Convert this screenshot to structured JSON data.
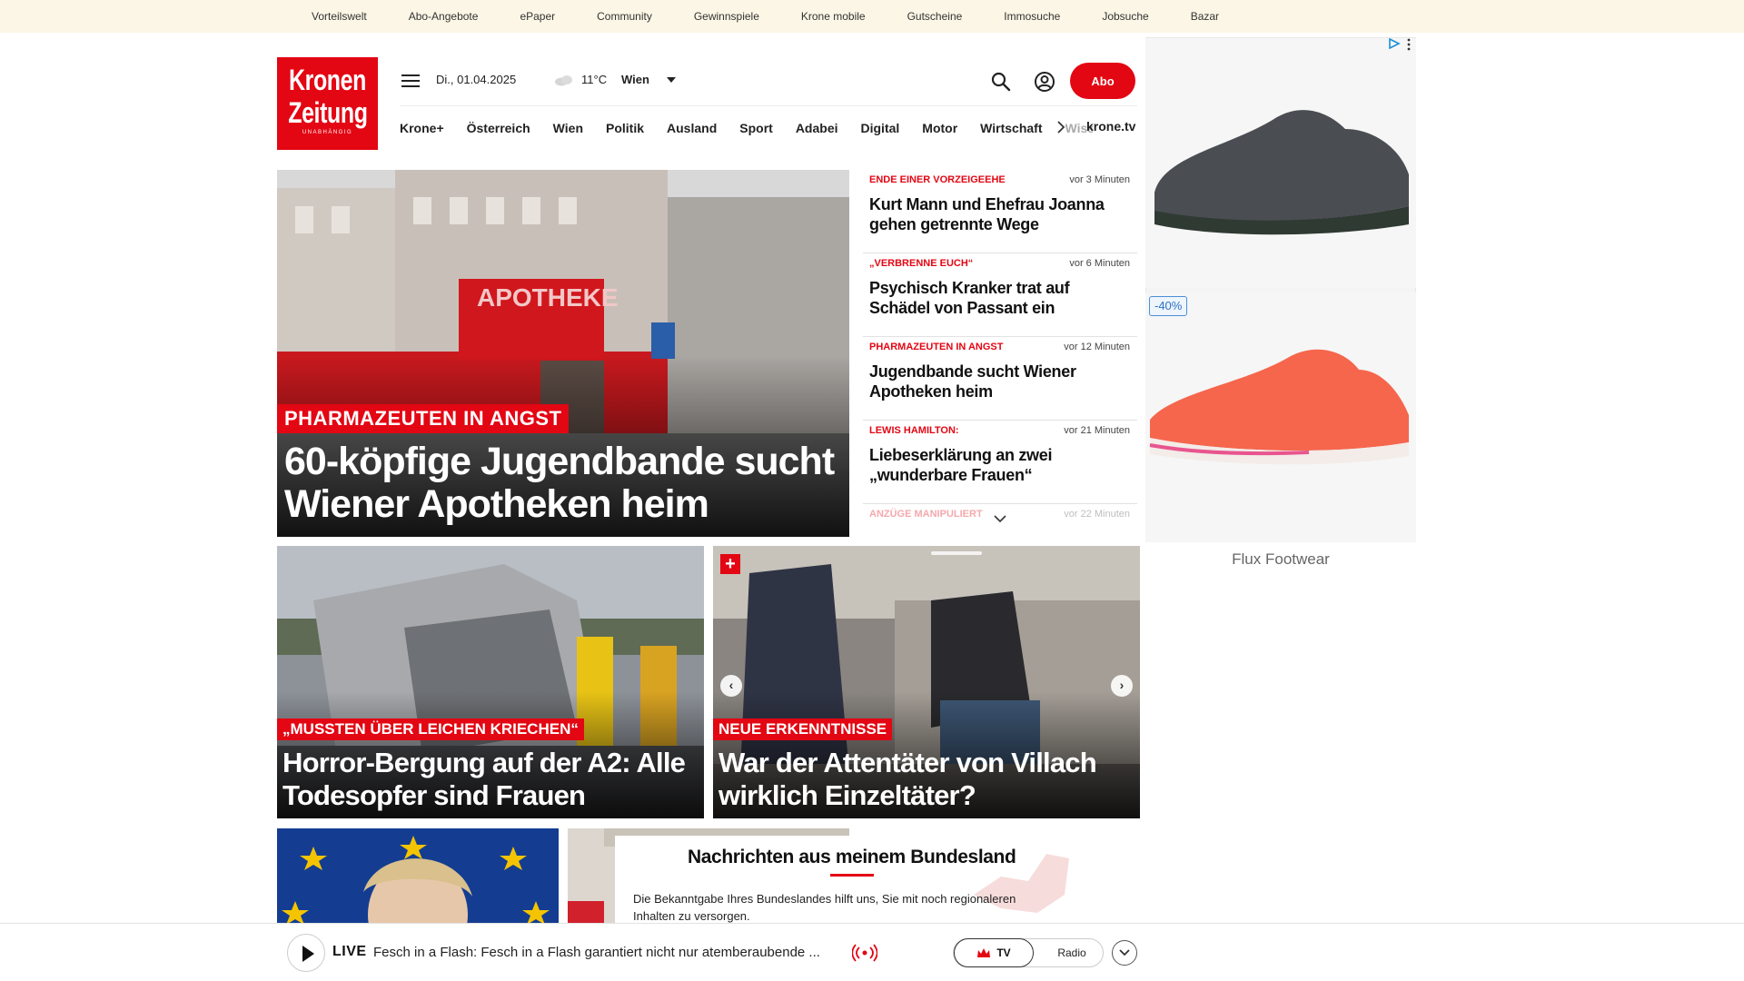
{
  "topbar": {
    "links": [
      "Vorteilswelt",
      "Abo-Angebote",
      "ePaper",
      "Community",
      "Gewinnspiele",
      "Krone mobile",
      "Gutscheine",
      "Immosuche",
      "Jobsuche",
      "Bazar"
    ]
  },
  "logo": {
    "line1": "Kronen",
    "line2": "Zeitung",
    "tagline": "UNABHÄNGIG",
    "color": "#e30613"
  },
  "header": {
    "date": "Di., 01.04.2025",
    "temperature": "11°C",
    "city": "Wien",
    "abo_label": "Abo"
  },
  "categories": [
    "Krone+",
    "Österreich",
    "Wien",
    "Politik",
    "Ausland",
    "Sport",
    "Adabei",
    "Digital",
    "Motor",
    "Wirtschaft",
    "Wiss"
  ],
  "kronetv_label": "krone.tv",
  "hero": {
    "kicker": "PHARMAZEUTEN IN ANGST",
    "title": "60-köpfige Jugendbande sucht Wiener Apotheken heim",
    "sign_text": "APOTHEKE"
  },
  "news": [
    {
      "kicker": "ENDE EINER VORZEIGEEHE",
      "time": "vor 3 Minuten",
      "title": "Kurt Mann und Ehefrau Joanna gehen getrennte Wege"
    },
    {
      "kicker": "„VERBRENNE EUCH“",
      "time": "vor 6 Minuten",
      "title": "Psychisch Kranker trat auf Schädel von Passant ein"
    },
    {
      "kicker": "PHARMAZEUTEN IN ANGST",
      "time": "vor 12 Minuten",
      "title": "Jugendbande sucht Wiener Apotheken heim"
    },
    {
      "kicker": "LEWIS HAMILTON:",
      "time": "vor 21 Minuten",
      "title": "Liebeserklärung an zwei „wunderbare Frauen“"
    },
    {
      "kicker": "ANZÜGE MANIPULIERT",
      "time": "vor 22 Minuten",
      "title": ""
    }
  ],
  "teasers": [
    {
      "kicker": "„MUSSTEN ÜBER LEICHEN KRIECHEN“",
      "title": "Horror-Bergung auf der A2: Alle Todesopfer sind Frauen"
    },
    {
      "kicker": "NEUE ERKENNTNISSE",
      "title": "War der Attentäter von Villach wirklich Einzeltäter?",
      "badge": "+"
    }
  ],
  "bundesland": {
    "title": "Nachrichten aus meinem Bundesland",
    "text": "Die Bekanntgabe Ihres Bundeslandes hilft uns, Sie mit noch regionaleren Inhalten zu versorgen."
  },
  "livebar": {
    "live_label": "LIVE",
    "text": "Fesch in a Flash: Fesch in a Flash garantiert nicht nur atemberaubende ...",
    "tv_label": "TV",
    "radio_label": "Radio"
  },
  "ad": {
    "discount": "-40%",
    "brand": "Flux Footwear"
  },
  "colors": {
    "brand_red": "#e30613",
    "topbar_bg": "#fbf6e5"
  }
}
